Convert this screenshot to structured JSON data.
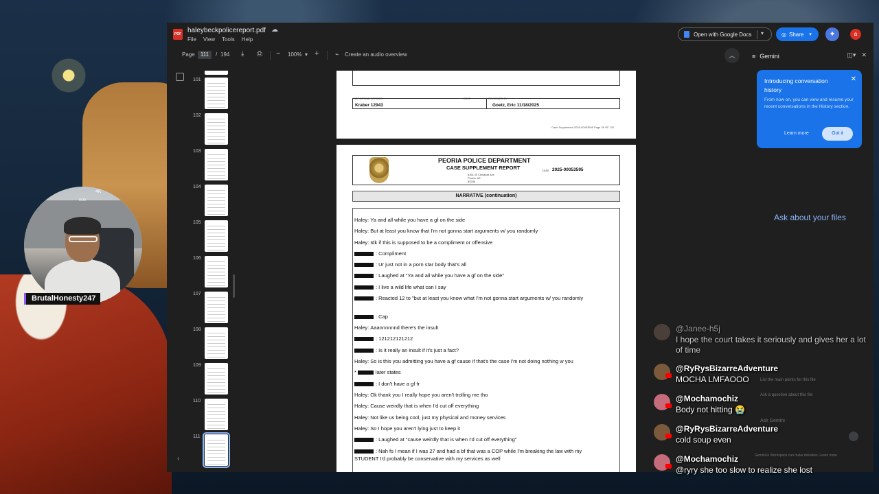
{
  "app": {
    "doc_title": "haleybeckpolicereport.pdf",
    "pdf_badge": "PDF",
    "menu": [
      "File",
      "View",
      "Tools",
      "Help"
    ],
    "open_with_label": "Open with Google Docs",
    "share_label": "Share",
    "avatar_letter": "a"
  },
  "toolbar": {
    "page_label": "Page",
    "current_page": "111",
    "page_sep": "/",
    "total_pages": "194",
    "zoom": "100%",
    "audio_overview_label": "Create an audio overview"
  },
  "thumbnails": [
    {
      "num": "101",
      "active": false
    },
    {
      "num": "102",
      "active": false
    },
    {
      "num": "103",
      "active": false
    },
    {
      "num": "104",
      "active": false
    },
    {
      "num": "105",
      "active": false
    },
    {
      "num": "106",
      "active": false
    },
    {
      "num": "107",
      "active": false
    },
    {
      "num": "108",
      "active": false
    },
    {
      "num": "109",
      "active": false
    },
    {
      "num": "110",
      "active": false
    },
    {
      "num": "111",
      "active": true
    }
  ],
  "page_prev": {
    "officer": "Kraber 12943",
    "reviewer": "Goetz, Eric 11/18/2025",
    "footer": "Case Supplement 2025-00053595 Page 39 OF 120"
  },
  "page_current": {
    "dept_name": "PEORIA POLICE DEPARTMENT",
    "report_type": "CASE SUPPLEMENT REPORT",
    "address": [
      "8351 W Cinnabar Ave",
      "Peoria, AZ",
      "85345"
    ],
    "case_label": "CASE",
    "case_number": "2025-00053595",
    "section_title": "NARRATIVE (continuation)",
    "lines": [
      {
        "speaker": "Haley:",
        "redacted": false,
        "text": "Ya and all while you have a gf on the side"
      },
      {
        "speaker": "Haley:",
        "redacted": false,
        "text": "But at least you know that I'm not gonna start arguments w/ you randomly"
      },
      {
        "speaker": "Haley:",
        "redacted": false,
        "text": "Idk if this is supposed to be a compliment or offensive"
      },
      {
        "speaker": "",
        "redacted": true,
        "text": ": Compliment"
      },
      {
        "speaker": "",
        "redacted": true,
        "text": ": Ur just not in a porn star body that's all"
      },
      {
        "speaker": "",
        "redacted": true,
        "text": ": Laughed at \"Ya and all while you have a gf on the side\""
      },
      {
        "speaker": "",
        "redacted": true,
        "text": ": I live a wild life what can I say"
      },
      {
        "speaker": "",
        "redacted": true,
        "text": ": Reacted 12 to \"but at least you know what I'm not gonna start arguments w/ you randomly"
      },
      {
        "speaker": "",
        "redacted": true,
        "text": ": Cap"
      },
      {
        "speaker": "Haley:",
        "redacted": false,
        "text": "Aaannnnnnd there's the insult"
      },
      {
        "speaker": "",
        "redacted": true,
        "text": ": 121212121212"
      },
      {
        "speaker": "",
        "redacted": true,
        "text": ": Is it really an insult if it's just a fact?"
      },
      {
        "speaker": "Haley:",
        "redacted": false,
        "text": "So is this you admitting you have a gf cause if that's the case I'm not doing nothing w you"
      },
      {
        "speaker": "*",
        "redacted": true,
        "text": "later states"
      },
      {
        "speaker": "",
        "redacted": true,
        "text": ": I don't have a gf fr"
      },
      {
        "speaker": "Haley:",
        "redacted": false,
        "text": "Ok thank you I really hope you aren't trolling me tho"
      },
      {
        "speaker": "Haley:",
        "redacted": false,
        "text": "Cause weirdly that is when I'd cut off everything"
      },
      {
        "speaker": "Haley:",
        "redacted": false,
        "text": "Not like us being cool, just my physical and money services"
      },
      {
        "speaker": "Haley:",
        "redacted": false,
        "text": "So I hope you aren't lying just to keep it"
      },
      {
        "speaker": "",
        "redacted": true,
        "text": ": Laughed at \"cause weirdly that is when I'd cut off everything\""
      },
      {
        "speaker": "",
        "redacted": true,
        "text": ": Nah fs I mean if I was 27 and had a bf that was a COP while I'm breaking the law with my"
      },
      {
        "speaker": "",
        "redacted": false,
        "text": "STUDENT I'd probably be conservative with my services as well"
      }
    ]
  },
  "gemini": {
    "title": "Gemini",
    "card_title": "Introducing conversation history",
    "card_body": "From now on, you can view and resume your recent conversations in the History section.",
    "learn_more": "Learn more",
    "got_it": "Got it",
    "ask_prompt": "Ask about your files",
    "suggestion_1": "List the main points for this file",
    "suggestion_2": "Ask a question about this file",
    "input_placeholder": "Ask Gemini",
    "footer": "Gemini in Workspace can make mistakes. Learn more"
  },
  "stream": {
    "username": "BrutalHonesty247",
    "cam_hud": "4K",
    "cam_hud2": "0:00",
    "accent_color": "#8b5cf6"
  },
  "chat": [
    {
      "user": "@Janee-h5j",
      "message": "I hope the court takes it seriously and gives her a lot of time",
      "avatar_color": "#5a4a42",
      "faded": true
    },
    {
      "user": "@RyRysBizarreAdventure",
      "message": "MOCHA LMFAOOO",
      "avatar_color": "#7a5a3a",
      "faded": false
    },
    {
      "user": "@Mochamochiz",
      "message": "Body not hitting 😭",
      "avatar_color": "#c56b7a",
      "faded": false
    },
    {
      "user": "@RyRysBizarreAdventure",
      "message": "cold soup even",
      "avatar_color": "#7a5a3a",
      "faded": false
    },
    {
      "user": "@Mochamochiz",
      "message": "@ryry she too slow to realize she lost",
      "avatar_color": "#c56b7a",
      "faded": false
    }
  ]
}
